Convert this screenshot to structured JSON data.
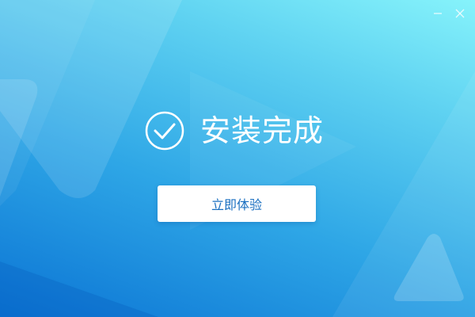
{
  "window": {
    "minimize_icon": "minimize-icon",
    "close_icon": "close-icon"
  },
  "main": {
    "status_icon": "checkmark-circle-icon",
    "title": "安装完成",
    "action_label": "立即体验"
  },
  "colors": {
    "gradient_top": "#86f3fb",
    "gradient_bottom": "#0b74d4",
    "button_text": "#1a6fc0",
    "button_background": "#ffffff"
  }
}
